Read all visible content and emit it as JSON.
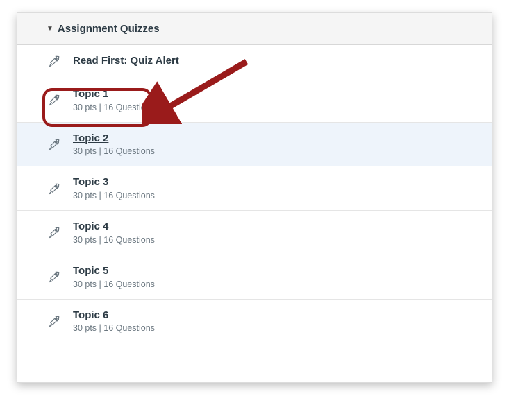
{
  "header": {
    "title": "Assignment Quizzes"
  },
  "rows": [
    {
      "title": "Read First: Quiz Alert",
      "meta": null,
      "hover": false
    },
    {
      "title": "Topic 1",
      "meta": "30 pts  |  16 Questions",
      "hover": false
    },
    {
      "title": "Topic 2",
      "meta": "30 pts  |  16 Questions",
      "hover": true
    },
    {
      "title": "Topic 3",
      "meta": "30 pts  |  16 Questions",
      "hover": false
    },
    {
      "title": "Topic 4",
      "meta": "30 pts  |  16 Questions",
      "hover": false
    },
    {
      "title": "Topic 5",
      "meta": "30 pts  |  16 Questions",
      "hover": false
    },
    {
      "title": "Topic 6",
      "meta": "30 pts  |  16 Questions",
      "hover": false
    }
  ],
  "annotation": {
    "color": "#9a1b1b"
  }
}
